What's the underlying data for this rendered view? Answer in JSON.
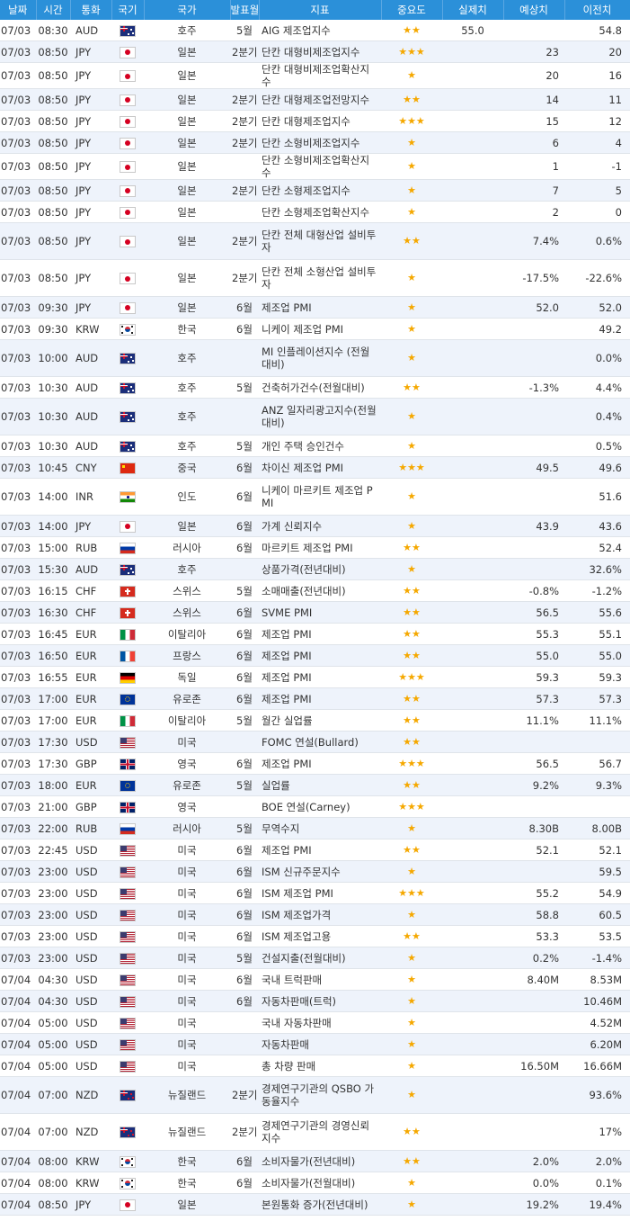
{
  "header": {
    "date": "날짜",
    "time": "시간",
    "currency": "통화",
    "flag": "국기",
    "country": "국가",
    "period": "발표월",
    "indicator": "지표",
    "importance": "중요도",
    "actual": "실제치",
    "forecast": "예상치",
    "previous": "이전치"
  },
  "rows": [
    {
      "date": "07/03",
      "time": "08:30",
      "cur": "AUD",
      "flag": "AU",
      "country": "호주",
      "period": "5월",
      "indicator": "AIG 제조업지수",
      "stars": "★★",
      "actual": "55.0",
      "forecast": "",
      "previous": "54.8"
    },
    {
      "date": "07/03",
      "time": "08:50",
      "cur": "JPY",
      "flag": "JP",
      "country": "일본",
      "period": "2분기",
      "indicator": "단칸 대형비제조업지수",
      "stars": "★★★",
      "actual": "",
      "forecast": "23",
      "previous": "20"
    },
    {
      "date": "07/03",
      "time": "08:50",
      "cur": "JPY",
      "flag": "JP",
      "country": "일본",
      "period": "",
      "indicator": "단칸 대형비제조업확산지수",
      "stars": "★",
      "actual": "",
      "forecast": "20",
      "previous": "16"
    },
    {
      "date": "07/03",
      "time": "08:50",
      "cur": "JPY",
      "flag": "JP",
      "country": "일본",
      "period": "2분기",
      "indicator": "단칸 대형제조업전망지수",
      "stars": "★★",
      "actual": "",
      "forecast": "14",
      "previous": "11"
    },
    {
      "date": "07/03",
      "time": "08:50",
      "cur": "JPY",
      "flag": "JP",
      "country": "일본",
      "period": "2분기",
      "indicator": "단칸 대형제조업지수",
      "stars": "★★★",
      "actual": "",
      "forecast": "15",
      "previous": "12"
    },
    {
      "date": "07/03",
      "time": "08:50",
      "cur": "JPY",
      "flag": "JP",
      "country": "일본",
      "period": "2분기",
      "indicator": "단칸 소형비제조업지수",
      "stars": "★",
      "actual": "",
      "forecast": "6",
      "previous": "4"
    },
    {
      "date": "07/03",
      "time": "08:50",
      "cur": "JPY",
      "flag": "JP",
      "country": "일본",
      "period": "",
      "indicator": "단칸 소형비제조업확산지수",
      "stars": "★",
      "actual": "",
      "forecast": "1",
      "previous": "-1"
    },
    {
      "date": "07/03",
      "time": "08:50",
      "cur": "JPY",
      "flag": "JP",
      "country": "일본",
      "period": "2분기",
      "indicator": "단칸 소형제조업지수",
      "stars": "★",
      "actual": "",
      "forecast": "7",
      "previous": "5"
    },
    {
      "date": "07/03",
      "time": "08:50",
      "cur": "JPY",
      "flag": "JP",
      "country": "일본",
      "period": "",
      "indicator": "단칸 소형제조업확산지수",
      "stars": "★",
      "actual": "",
      "forecast": "2",
      "previous": "0"
    },
    {
      "date": "07/03",
      "time": "08:50",
      "cur": "JPY",
      "flag": "JP",
      "country": "일본",
      "period": "2분기",
      "indicator": "단칸 전체 대형산업 설비투자",
      "stars": "★★",
      "actual": "",
      "forecast": "7.4%",
      "previous": "0.6%",
      "tall": true
    },
    {
      "date": "07/03",
      "time": "08:50",
      "cur": "JPY",
      "flag": "JP",
      "country": "일본",
      "period": "2분기",
      "indicator": "단칸 전체 소형산업 설비투자",
      "stars": "★",
      "actual": "",
      "forecast": "-17.5%",
      "previous": "-22.6%",
      "tall": true
    },
    {
      "date": "07/03",
      "time": "09:30",
      "cur": "JPY",
      "flag": "JP",
      "country": "일본",
      "period": "6월",
      "indicator": "제조업 PMI",
      "stars": "★",
      "actual": "",
      "forecast": "52.0",
      "previous": "52.0"
    },
    {
      "date": "07/03",
      "time": "09:30",
      "cur": "KRW",
      "flag": "KR",
      "country": "한국",
      "period": "6월",
      "indicator": "니케이 제조업 PMI",
      "stars": "★",
      "actual": "",
      "forecast": "",
      "previous": "49.2"
    },
    {
      "date": "07/03",
      "time": "10:00",
      "cur": "AUD",
      "flag": "AU",
      "country": "호주",
      "period": "",
      "indicator": "MI 인플레이션지수 (전월대비)",
      "stars": "★",
      "actual": "",
      "forecast": "",
      "previous": "0.0%",
      "tall": true
    },
    {
      "date": "07/03",
      "time": "10:30",
      "cur": "AUD",
      "flag": "AU",
      "country": "호주",
      "period": "5월",
      "indicator": "건축허가건수(전월대비)",
      "stars": "★★",
      "actual": "",
      "forecast": "-1.3%",
      "previous": "4.4%"
    },
    {
      "date": "07/03",
      "time": "10:30",
      "cur": "AUD",
      "flag": "AU",
      "country": "호주",
      "period": "",
      "indicator": "ANZ 일자리광고지수(전월대비)",
      "stars": "★",
      "actual": "",
      "forecast": "",
      "previous": "0.4%",
      "tall": true
    },
    {
      "date": "07/03",
      "time": "10:30",
      "cur": "AUD",
      "flag": "AU",
      "country": "호주",
      "period": "5월",
      "indicator": "개인 주택 승인건수",
      "stars": "★",
      "actual": "",
      "forecast": "",
      "previous": "0.5%"
    },
    {
      "date": "07/03",
      "time": "10:45",
      "cur": "CNY",
      "flag": "CN",
      "country": "중국",
      "period": "6월",
      "indicator": "차이신 제조업 PMI",
      "stars": "★★★",
      "actual": "",
      "forecast": "49.5",
      "previous": "49.6"
    },
    {
      "date": "07/03",
      "time": "14:00",
      "cur": "INR",
      "flag": "IN",
      "country": "인도",
      "period": "6월",
      "indicator": "니케이 마르키트 제조업 PMI",
      "stars": "★",
      "actual": "",
      "forecast": "",
      "previous": "51.6",
      "tall": true
    },
    {
      "date": "07/03",
      "time": "14:00",
      "cur": "JPY",
      "flag": "JP",
      "country": "일본",
      "period": "6월",
      "indicator": "가계 신뢰지수",
      "stars": "★",
      "actual": "",
      "forecast": "43.9",
      "previous": "43.6"
    },
    {
      "date": "07/03",
      "time": "15:00",
      "cur": "RUB",
      "flag": "RU",
      "country": "러시아",
      "period": "6월",
      "indicator": "마르키트 제조업 PMI",
      "stars": "★★",
      "actual": "",
      "forecast": "",
      "previous": "52.4"
    },
    {
      "date": "07/03",
      "time": "15:30",
      "cur": "AUD",
      "flag": "AU",
      "country": "호주",
      "period": "",
      "indicator": "상품가격(전년대비)",
      "stars": "★",
      "actual": "",
      "forecast": "",
      "previous": "32.6%"
    },
    {
      "date": "07/03",
      "time": "16:15",
      "cur": "CHF",
      "flag": "CH",
      "country": "스위스",
      "period": "5월",
      "indicator": "소매매출(전년대비)",
      "stars": "★★",
      "actual": "",
      "forecast": "-0.8%",
      "previous": "-1.2%"
    },
    {
      "date": "07/03",
      "time": "16:30",
      "cur": "CHF",
      "flag": "CH",
      "country": "스위스",
      "period": "6월",
      "indicator": "SVME PMI",
      "stars": "★★",
      "actual": "",
      "forecast": "56.5",
      "previous": "55.6"
    },
    {
      "date": "07/03",
      "time": "16:45",
      "cur": "EUR",
      "flag": "IT",
      "country": "이탈리아",
      "period": "6월",
      "indicator": "제조업 PMI",
      "stars": "★★",
      "actual": "",
      "forecast": "55.3",
      "previous": "55.1"
    },
    {
      "date": "07/03",
      "time": "16:50",
      "cur": "EUR",
      "flag": "FR",
      "country": "프랑스",
      "period": "6월",
      "indicator": "제조업 PMI",
      "stars": "★★",
      "actual": "",
      "forecast": "55.0",
      "previous": "55.0"
    },
    {
      "date": "07/03",
      "time": "16:55",
      "cur": "EUR",
      "flag": "DE",
      "country": "독일",
      "period": "6월",
      "indicator": "제조업 PMI",
      "stars": "★★★",
      "actual": "",
      "forecast": "59.3",
      "previous": "59.3"
    },
    {
      "date": "07/03",
      "time": "17:00",
      "cur": "EUR",
      "flag": "EU",
      "country": "유로존",
      "period": "6월",
      "indicator": "제조업 PMI",
      "stars": "★★",
      "actual": "",
      "forecast": "57.3",
      "previous": "57.3"
    },
    {
      "date": "07/03",
      "time": "17:00",
      "cur": "EUR",
      "flag": "IT",
      "country": "이탈리아",
      "period": "5월",
      "indicator": "월간 실업률",
      "stars": "★★",
      "actual": "",
      "forecast": "11.1%",
      "previous": "11.1%"
    },
    {
      "date": "07/03",
      "time": "17:30",
      "cur": "USD",
      "flag": "US",
      "country": "미국",
      "period": "",
      "indicator": "FOMC 연설(Bullard)",
      "stars": "★★",
      "actual": "",
      "forecast": "",
      "previous": ""
    },
    {
      "date": "07/03",
      "time": "17:30",
      "cur": "GBP",
      "flag": "GB",
      "country": "영국",
      "period": "6월",
      "indicator": "제조업 PMI",
      "stars": "★★★",
      "actual": "",
      "forecast": "56.5",
      "previous": "56.7"
    },
    {
      "date": "07/03",
      "time": "18:00",
      "cur": "EUR",
      "flag": "EU",
      "country": "유로존",
      "period": "5월",
      "indicator": "실업률",
      "stars": "★★",
      "actual": "",
      "forecast": "9.2%",
      "previous": "9.3%"
    },
    {
      "date": "07/03",
      "time": "21:00",
      "cur": "GBP",
      "flag": "GB",
      "country": "영국",
      "period": "",
      "indicator": "BOE 연설(Carney)",
      "stars": "★★★",
      "actual": "",
      "forecast": "",
      "previous": ""
    },
    {
      "date": "07/03",
      "time": "22:00",
      "cur": "RUB",
      "flag": "RU",
      "country": "러시아",
      "period": "5월",
      "indicator": "무역수지",
      "stars": "★",
      "actual": "",
      "forecast": "8.30B",
      "previous": "8.00B"
    },
    {
      "date": "07/03",
      "time": "22:45",
      "cur": "USD",
      "flag": "US",
      "country": "미국",
      "period": "6월",
      "indicator": "제조업 PMI",
      "stars": "★★",
      "actual": "",
      "forecast": "52.1",
      "previous": "52.1"
    },
    {
      "date": "07/03",
      "time": "23:00",
      "cur": "USD",
      "flag": "US",
      "country": "미국",
      "period": "6월",
      "indicator": "ISM 신규주문지수",
      "stars": "★",
      "actual": "",
      "forecast": "",
      "previous": "59.5"
    },
    {
      "date": "07/03",
      "time": "23:00",
      "cur": "USD",
      "flag": "US",
      "country": "미국",
      "period": "6월",
      "indicator": "ISM 제조업 PMI",
      "stars": "★★★",
      "actual": "",
      "forecast": "55.2",
      "previous": "54.9"
    },
    {
      "date": "07/03",
      "time": "23:00",
      "cur": "USD",
      "flag": "US",
      "country": "미국",
      "period": "6월",
      "indicator": "ISM 제조업가격",
      "stars": "★",
      "actual": "",
      "forecast": "58.8",
      "previous": "60.5"
    },
    {
      "date": "07/03",
      "time": "23:00",
      "cur": "USD",
      "flag": "US",
      "country": "미국",
      "period": "6월",
      "indicator": "ISM 제조업고용",
      "stars": "★★",
      "actual": "",
      "forecast": "53.3",
      "previous": "53.5"
    },
    {
      "date": "07/03",
      "time": "23:00",
      "cur": "USD",
      "flag": "US",
      "country": "미국",
      "period": "5월",
      "indicator": "건설지출(전월대비)",
      "stars": "★",
      "actual": "",
      "forecast": "0.2%",
      "previous": "-1.4%"
    },
    {
      "date": "07/04",
      "time": "04:30",
      "cur": "USD",
      "flag": "US",
      "country": "미국",
      "period": "6월",
      "indicator": "국내 트럭판매",
      "stars": "★",
      "actual": "",
      "forecast": "8.40M",
      "previous": "8.53M"
    },
    {
      "date": "07/04",
      "time": "04:30",
      "cur": "USD",
      "flag": "US",
      "country": "미국",
      "period": "6월",
      "indicator": "자동차판매(트럭)",
      "stars": "★",
      "actual": "",
      "forecast": "",
      "previous": "10.46M"
    },
    {
      "date": "07/04",
      "time": "05:00",
      "cur": "USD",
      "flag": "US",
      "country": "미국",
      "period": "",
      "indicator": "국내 자동차판매",
      "stars": "★",
      "actual": "",
      "forecast": "",
      "previous": "4.52M"
    },
    {
      "date": "07/04",
      "time": "05:00",
      "cur": "USD",
      "flag": "US",
      "country": "미국",
      "period": "",
      "indicator": "자동차판매",
      "stars": "★",
      "actual": "",
      "forecast": "",
      "previous": "6.20M"
    },
    {
      "date": "07/04",
      "time": "05:00",
      "cur": "USD",
      "flag": "US",
      "country": "미국",
      "period": "",
      "indicator": "총 차량 판매",
      "stars": "★",
      "actual": "",
      "forecast": "16.50M",
      "previous": "16.66M"
    },
    {
      "date": "07/04",
      "time": "07:00",
      "cur": "NZD",
      "flag": "NZ",
      "country": "뉴질랜드",
      "period": "2분기",
      "indicator": "경제연구기관의 QSBO 가동율지수",
      "stars": "★",
      "actual": "",
      "forecast": "",
      "previous": "93.6%",
      "tall": true
    },
    {
      "date": "07/04",
      "time": "07:00",
      "cur": "NZD",
      "flag": "NZ",
      "country": "뉴질랜드",
      "period": "2분기",
      "indicator": "경제연구기관의 경영신뢰지수",
      "stars": "★★",
      "actual": "",
      "forecast": "",
      "previous": "17%",
      "tall": true
    },
    {
      "date": "07/04",
      "time": "08:00",
      "cur": "KRW",
      "flag": "KR",
      "country": "한국",
      "period": "6월",
      "indicator": "소비자물가(전년대비)",
      "stars": "★★",
      "actual": "",
      "forecast": "2.0%",
      "previous": "2.0%"
    },
    {
      "date": "07/04",
      "time": "08:00",
      "cur": "KRW",
      "flag": "KR",
      "country": "한국",
      "period": "6월",
      "indicator": "소비자물가(전월대비)",
      "stars": "★",
      "actual": "",
      "forecast": "0.0%",
      "previous": "0.1%"
    },
    {
      "date": "07/04",
      "time": "08:50",
      "cur": "JPY",
      "flag": "JP",
      "country": "일본",
      "period": "",
      "indicator": "본원통화 증가(전년대비)",
      "stars": "★",
      "actual": "",
      "forecast": "19.2%",
      "previous": "19.4%"
    }
  ]
}
